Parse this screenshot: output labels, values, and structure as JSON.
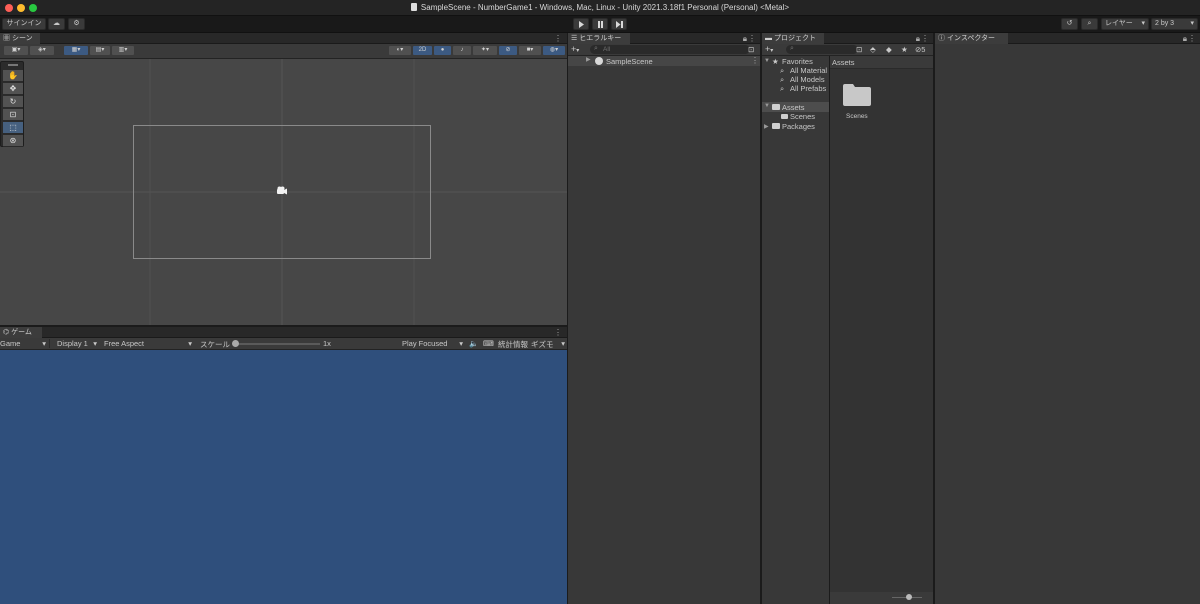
{
  "window": {
    "title": "SampleScene - NumberGame1 - Windows, Mac, Linux - Unity 2021.3.18f1 Personal (Personal) <Metal>"
  },
  "toolbar": {
    "signin_label": "サインイン",
    "play_icon": "play-icon",
    "pause_icon": "pause-icon",
    "step_icon": "step-icon",
    "layers_label": "レイヤー",
    "layout_label": "2 by 3"
  },
  "scene": {
    "tab_label": "シーン",
    "mode_2d": "2D",
    "tools": [
      "hand",
      "move",
      "rotate",
      "scale",
      "rect",
      "transform"
    ],
    "active_tool": "rect"
  },
  "game": {
    "tab_label": "ゲーム",
    "view_dropdown": "Game",
    "display_dropdown": "Display 1",
    "aspect_dropdown": "Free Aspect",
    "scale_label": "スケール",
    "scale_value": "1x",
    "play_mode_dropdown": "Play Focused",
    "stats_label": "統計情報",
    "gizmos_label": "ギズモ",
    "background_color": "#2f4f7c"
  },
  "hierarchy": {
    "tab_label": "ヒエラルキー",
    "search_placeholder": "All",
    "items": [
      "SampleScene"
    ]
  },
  "project": {
    "tab_label": "プロジェクト",
    "favorites_label": "Favorites",
    "favorites": [
      "All Material",
      "All Models",
      "All Prefabs"
    ],
    "assets_label": "Assets",
    "asset_children": [
      "Scenes"
    ],
    "packages_label": "Packages",
    "breadcrumb": "Assets",
    "grid_items": [
      "Scenes"
    ],
    "hidden_count": "5"
  },
  "inspector": {
    "tab_label": "インスペクター"
  }
}
